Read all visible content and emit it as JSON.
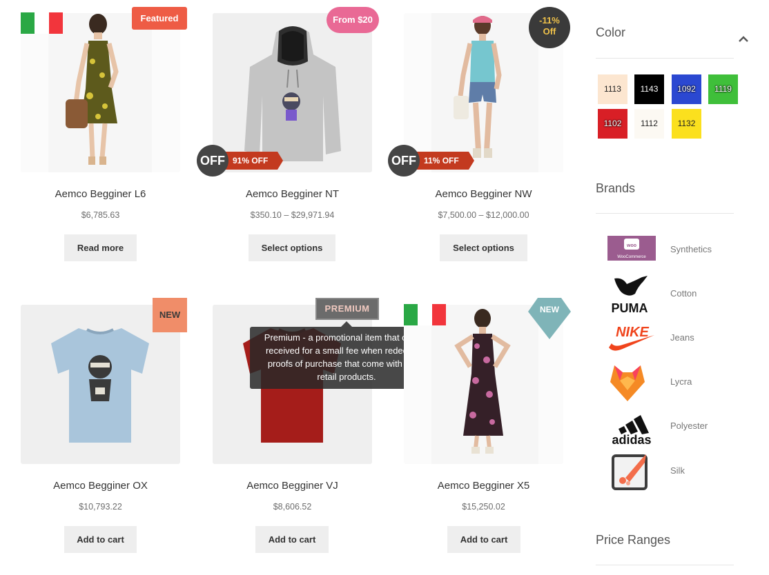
{
  "products": [
    {
      "title": "Aemco Begginer L6",
      "price": "$6,785.63",
      "button": "Read more"
    },
    {
      "title": "Aemco Begginer NT",
      "price": "$350.10 – $29,971.94",
      "button": "Select options"
    },
    {
      "title": "Aemco Begginer NW",
      "price": "$7,500.00 – $12,000.00",
      "button": "Select options"
    },
    {
      "title": "Aemco Begginer OX",
      "price": "$10,793.22",
      "button": "Add to cart"
    },
    {
      "title": "Aemco Begginer VJ",
      "price": "$8,606.52",
      "button": "Add to cart"
    },
    {
      "title": "Aemco Begginer X5",
      "price": "$15,250.02",
      "button": "Add to cart"
    }
  ],
  "badges": {
    "featured": "Featured",
    "from": "From $20",
    "discount_pct": "-11%",
    "discount_word": "Off",
    "off_circle": "OFF",
    "off_nt": "91% OFF",
    "off_nw": "11% OFF",
    "new": "NEW",
    "premium": "PREMIUM",
    "new_diamond": "NEW"
  },
  "tooltip": "Premium - a promotional item that can be received for a small fee when redeeming proofs of purchase that come with or on retail products.",
  "sidebar": {
    "color_title": "Color",
    "colors": [
      {
        "label": "1113",
        "hex": "#fce6d0"
      },
      {
        "label": "1143",
        "hex": "#000000"
      },
      {
        "label": "1092",
        "hex": "#2b48d1"
      },
      {
        "label": "1119",
        "hex": "#3fbf3a"
      },
      {
        "label": "1102",
        "hex": "#d81f26"
      },
      {
        "label": "1112",
        "hex": "#fcf9f3"
      },
      {
        "label": "1132",
        "hex": "#fbe01e"
      }
    ],
    "brands_title": "Brands",
    "brands": [
      {
        "name": "Synthetics",
        "icon": "woocommerce-logo",
        "logo_text": "WooCommerce"
      },
      {
        "name": "Cotton",
        "icon": "puma-logo",
        "logo_text": "PUMA"
      },
      {
        "name": "Jeans",
        "icon": "nike-logo",
        "logo_text": "NIKE"
      },
      {
        "name": "Lycra",
        "icon": "fox-logo"
      },
      {
        "name": "Polyester",
        "icon": "adidas-logo",
        "logo_text": "adidas"
      },
      {
        "name": "Silk",
        "icon": "rocket-logo"
      }
    ],
    "price_title": "Price Ranges"
  }
}
